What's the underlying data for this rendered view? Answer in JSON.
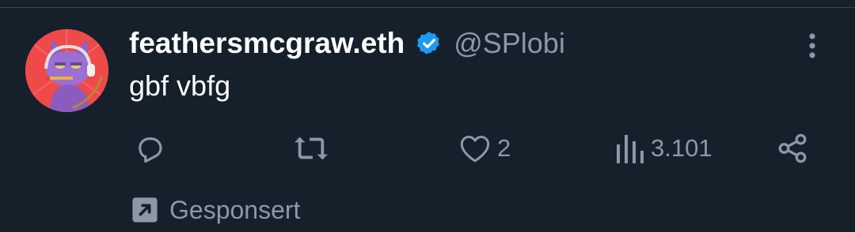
{
  "tweet": {
    "display_name": "feathersmcgraw.eth",
    "handle": "@SPlobi",
    "text": "gbf vbfg",
    "verified": true,
    "avatar_icon": "purple-cat-with-headphones-avatar"
  },
  "actions": {
    "reply": {
      "icon": "reply-icon",
      "count": ""
    },
    "retweet": {
      "icon": "retweet-icon",
      "count": ""
    },
    "like": {
      "icon": "heart-icon",
      "count": "2"
    },
    "views": {
      "icon": "views-bar-chart-icon",
      "count": "3.101"
    },
    "share": {
      "icon": "share-icon"
    }
  },
  "promo": {
    "label": "Gesponsert",
    "icon": "promoted-arrow-icon"
  },
  "colors": {
    "background": "#15202b",
    "secondary_text": "#8b98a5",
    "verified_blue": "#1d9bf0",
    "divider": "#38444d"
  }
}
